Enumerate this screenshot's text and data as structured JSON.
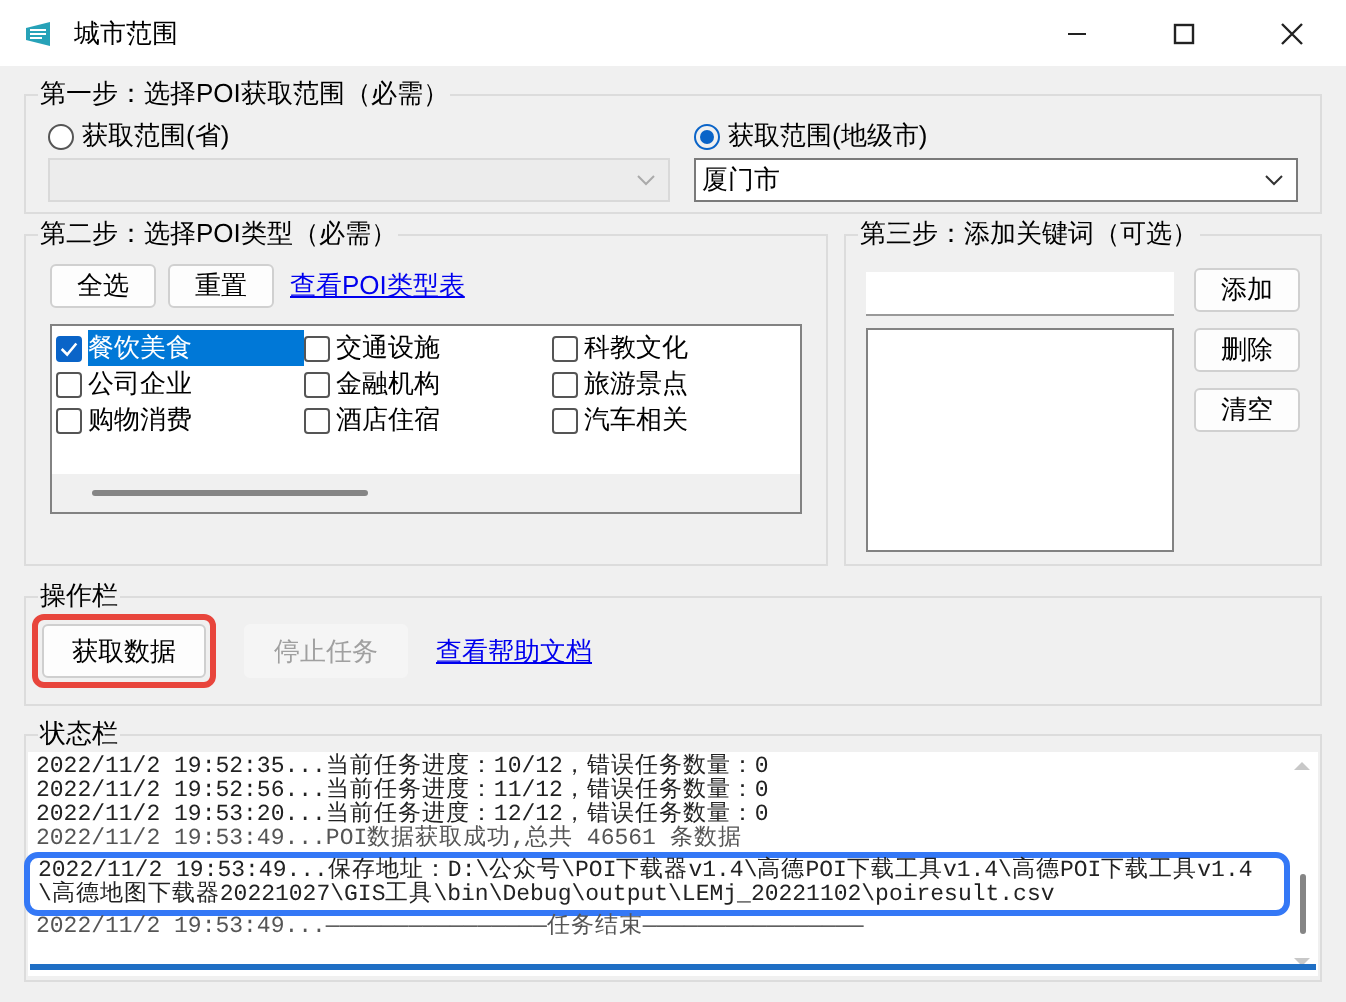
{
  "window": {
    "title": "城市范围"
  },
  "step1": {
    "title": "第一步：选择POI获取范围（必需）",
    "options": [
      {
        "label": "获取范围(省)",
        "selected": false,
        "disabled": true
      },
      {
        "label": "获取范围(地级市)",
        "selected": true,
        "value": "厦门市",
        "disabled": false
      }
    ]
  },
  "step2": {
    "title": "第二步：选择POI类型（必需）",
    "buttons": [
      "全选",
      "重置"
    ],
    "link": "查看POI类型表",
    "types": [
      {
        "label": "餐饮美食",
        "checked": true,
        "selected": true
      },
      {
        "label": "交通设施",
        "checked": false,
        "selected": false
      },
      {
        "label": "科教文化",
        "checked": false,
        "selected": false
      },
      {
        "label": "公司企业",
        "checked": false,
        "selected": false
      },
      {
        "label": "金融机构",
        "checked": false,
        "selected": false
      },
      {
        "label": "旅游景点",
        "checked": false,
        "selected": false
      },
      {
        "label": "购物消费",
        "checked": false,
        "selected": false
      },
      {
        "label": "酒店住宿",
        "checked": false,
        "selected": false
      },
      {
        "label": "汽车相关",
        "checked": false,
        "selected": false
      }
    ]
  },
  "step3": {
    "title": "第三步：添加关键词（可选）",
    "buttons": [
      "添加",
      "删除",
      "清空"
    ]
  },
  "actions": {
    "title": "操作栏",
    "buttons": [
      {
        "label": "获取数据",
        "disabled": false,
        "highlighted": true
      },
      {
        "label": "停止任务",
        "disabled": true,
        "highlighted": false
      }
    ],
    "link": "查看帮助文档"
  },
  "status": {
    "title": "状态栏",
    "progress": {
      "level": 1
    },
    "log": [
      {
        "text": "2022/11/2 19:52:35...当前任务进度：10/12，错误任务数量：0",
        "kind": "line"
      },
      {
        "text": "2022/11/2 19:52:56...当前任务进度：11/12，错误任务数量：0",
        "kind": "line"
      },
      {
        "text": "2022/11/2 19:53:20...当前任务进度：12/12，错误任务数量：0",
        "kind": "line"
      },
      {
        "text": "2022/11/2 19:53:49...POI数据获取成功,总共 46561 条数据",
        "kind": "cut_bottom"
      },
      {
        "text": "2022/11/2 19:53:49...保存地址：D:\\公众号\\POI下载器v1.4\\高德POI下载工具v1.4\\高德POI下载工具v1.4\\高德地图下载器20221027\\GIS工具\\bin\\Debug\\output\\LEMj_20221102\\poiresult.csv",
        "kind": "highlighted"
      },
      {
        "text": "2022/11/2 19:53:49...————————————————任务结束————————————————",
        "kind": "cut_top"
      }
    ]
  }
}
